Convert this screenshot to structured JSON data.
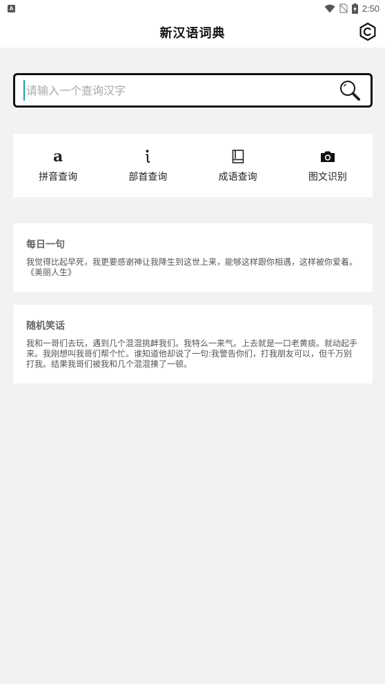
{
  "status_bar": {
    "notification_badge": "A",
    "time": "2:50"
  },
  "app_bar": {
    "title": "新汉语词典"
  },
  "search": {
    "placeholder": "请输入一个查询汉字",
    "value": ""
  },
  "menu": {
    "items": [
      {
        "icon": "a",
        "icon_name": "letter-a-icon",
        "label": "拼音查询"
      },
      {
        "icon": "i",
        "icon_name": "radical-icon",
        "label": "部首查询"
      },
      {
        "icon": "",
        "icon_name": "book-icon",
        "label": "成语查询"
      },
      {
        "icon": "",
        "icon_name": "camera-icon",
        "label": "图文识别"
      }
    ]
  },
  "daily_sentence": {
    "title": "每日一句",
    "text": "我觉得比起早死，我更要感谢神让我降生到这世上来，能够这样跟你相遇，这样被你爱着。《美丽人生》"
  },
  "random_joke": {
    "title": "随机笑话",
    "text": "我和一哥们去玩，遇到几个混混挑衅我们。我特么一来气。上去就是一口老黄痰。就动起手来。我刚想叫我哥们帮个忙。谁知道他却说了一句:我警告你们，打我朋友可以，但千万别打我。结果我哥们被我和几个混混揍了一顿。"
  },
  "colors": {
    "background": "#f2f2f2",
    "card": "#ffffff",
    "cursor_accent": "#1aa3a3"
  }
}
